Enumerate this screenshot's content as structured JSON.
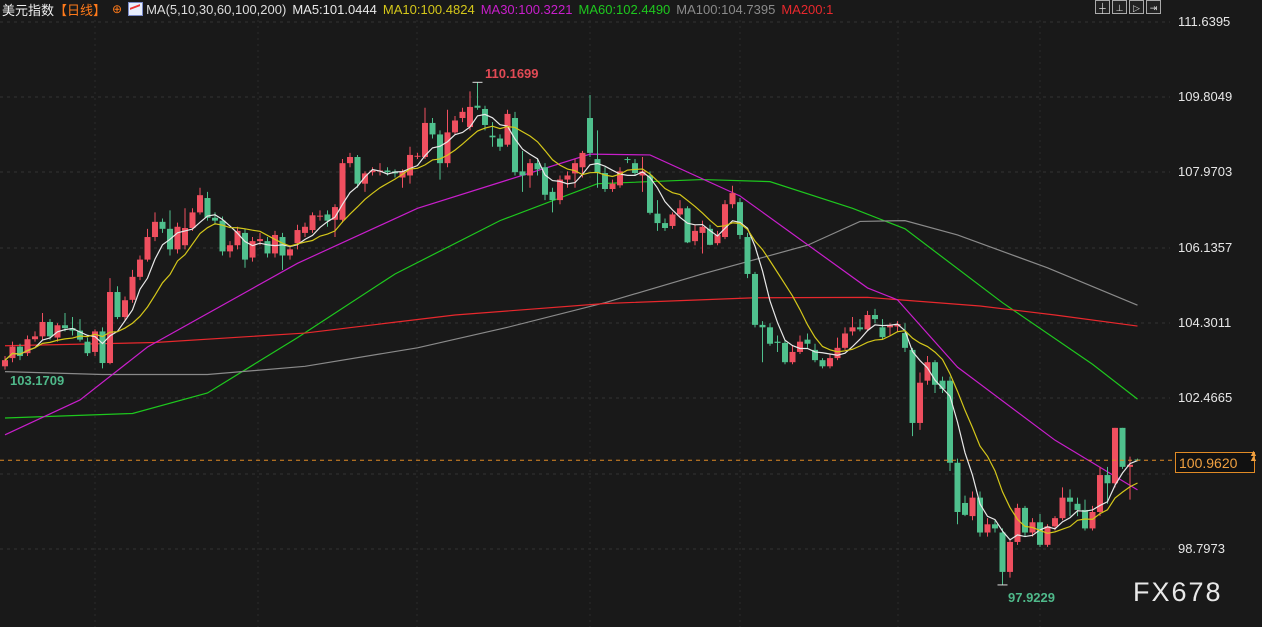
{
  "header": {
    "title": "美元指数",
    "period": "【日线】",
    "ma_set": "MA(5,10,30,60,100,200)",
    "ma_labels": [
      {
        "text": "MA5:101.0444",
        "color": "#e8e8e8"
      },
      {
        "text": "MA10:100.4824",
        "color": "#d4c71a"
      },
      {
        "text": "MA30:100.3221",
        "color": "#c81ecb"
      },
      {
        "text": "MA60:102.4490",
        "color": "#1ec81e"
      },
      {
        "text": "MA100:104.7395",
        "color": "#8a8a8a"
      },
      {
        "text": "MA200:1",
        "color": "#e8282d"
      }
    ]
  },
  "toolbar": [
    "crosshair-icon",
    "zoom-range-icon",
    "play-icon",
    "exit-icon"
  ],
  "axis": {
    "labels": [
      "111.6395",
      "109.8049",
      "107.9703",
      "106.1357",
      "104.3011",
      "102.4665",
      "98.7973"
    ],
    "current_price": "100.9620"
  },
  "annotations": {
    "high": "110.1699",
    "low_left": "103.1709",
    "low": "97.9229"
  },
  "watermark": "FX678",
  "colors": {
    "up": "#ef4f5f",
    "down": "#4fc08d",
    "background": "#191919",
    "current_line": "#e08a25"
  },
  "chart_data": {
    "type": "candlestick",
    "ylim": [
      97.5,
      111.6395
    ],
    "grid": true,
    "ohlc": [
      [
        103.25,
        103.5,
        103.17,
        103.4
      ],
      [
        103.45,
        103.85,
        103.35,
        103.73
      ],
      [
        103.73,
        103.8,
        103.4,
        103.5
      ],
      [
        103.57,
        104.0,
        103.5,
        103.91
      ],
      [
        103.91,
        104.1,
        103.85,
        103.98
      ],
      [
        103.98,
        104.55,
        103.9,
        104.33
      ],
      [
        104.33,
        104.4,
        103.9,
        103.98
      ],
      [
        103.95,
        104.3,
        103.85,
        104.25
      ],
      [
        104.25,
        104.55,
        104.1,
        104.18
      ],
      [
        104.18,
        104.45,
        104.0,
        104.12
      ],
      [
        104.12,
        104.4,
        103.85,
        103.9
      ],
      [
        103.85,
        103.95,
        103.5,
        103.57
      ],
      [
        103.6,
        104.15,
        103.5,
        104.1
      ],
      [
        104.1,
        104.2,
        103.2,
        103.33
      ],
      [
        103.33,
        105.4,
        103.3,
        105.06
      ],
      [
        105.06,
        105.2,
        104.4,
        104.45
      ],
      [
        104.45,
        104.95,
        104.35,
        104.86
      ],
      [
        104.87,
        105.6,
        104.8,
        105.43
      ],
      [
        105.43,
        105.95,
        105.35,
        105.85
      ],
      [
        105.85,
        106.6,
        105.8,
        106.4
      ],
      [
        106.4,
        107.0,
        106.3,
        106.77
      ],
      [
        106.77,
        106.85,
        106.5,
        106.6
      ],
      [
        106.6,
        107.05,
        105.95,
        106.1
      ],
      [
        106.1,
        106.75,
        106.0,
        106.65
      ],
      [
        106.2,
        107.1,
        106.1,
        106.62
      ],
      [
        106.62,
        107.1,
        106.55,
        107.0
      ],
      [
        107.0,
        107.6,
        106.95,
        107.42
      ],
      [
        107.35,
        107.5,
        106.8,
        106.87
      ],
      [
        106.87,
        107.0,
        106.7,
        106.8
      ],
      [
        106.8,
        106.9,
        105.95,
        106.05
      ],
      [
        106.05,
        106.3,
        105.9,
        106.2
      ],
      [
        106.2,
        106.65,
        106.1,
        106.55
      ],
      [
        106.5,
        106.6,
        105.65,
        105.85
      ],
      [
        105.9,
        106.4,
        105.8,
        106.3
      ],
      [
        106.3,
        106.5,
        106.2,
        106.35
      ],
      [
        106.3,
        106.4,
        105.9,
        106.0
      ],
      [
        106.0,
        106.55,
        105.9,
        106.45
      ],
      [
        106.4,
        106.5,
        105.6,
        105.95
      ],
      [
        105.95,
        106.2,
        105.85,
        106.1
      ],
      [
        106.25,
        106.7,
        106.1,
        106.57
      ],
      [
        106.5,
        106.75,
        106.4,
        106.65
      ],
      [
        106.57,
        107.0,
        106.5,
        106.93
      ],
      [
        106.9,
        107.05,
        106.8,
        106.92
      ],
      [
        106.95,
        107.05,
        106.65,
        106.8
      ],
      [
        106.82,
        107.2,
        106.4,
        107.13
      ],
      [
        106.82,
        108.3,
        106.75,
        108.2
      ],
      [
        108.2,
        108.45,
        108.1,
        108.35
      ],
      [
        108.35,
        108.4,
        107.6,
        107.7
      ],
      [
        107.7,
        108.0,
        107.5,
        107.95
      ],
      [
        107.98,
        108.1,
        107.9,
        108.02
      ],
      [
        108.0,
        108.2,
        107.9,
        108.02
      ],
      [
        108.02,
        108.1,
        107.9,
        107.98
      ],
      [
        108.0,
        108.05,
        107.85,
        107.95
      ],
      [
        107.85,
        108.05,
        107.6,
        108.0
      ],
      [
        107.9,
        108.6,
        107.7,
        108.4
      ],
      [
        108.37,
        108.45,
        108.3,
        108.38
      ],
      [
        108.35,
        109.55,
        108.3,
        109.18
      ],
      [
        109.18,
        109.3,
        108.8,
        108.9
      ],
      [
        108.9,
        109.0,
        107.8,
        108.2
      ],
      [
        108.2,
        109.5,
        108.1,
        108.95
      ],
      [
        108.95,
        109.35,
        108.9,
        109.24
      ],
      [
        109.3,
        109.55,
        109.2,
        109.45
      ],
      [
        109.08,
        109.95,
        109.0,
        109.57
      ],
      [
        109.6,
        110.1699,
        109.5,
        109.55
      ],
      [
        109.52,
        109.6,
        109.0,
        109.13
      ],
      [
        108.87,
        109.2,
        108.6,
        108.83
      ],
      [
        108.8,
        108.9,
        108.5,
        108.6
      ],
      [
        108.65,
        109.5,
        108.6,
        109.4
      ],
      [
        109.3,
        109.45,
        107.9,
        107.98
      ],
      [
        108.0,
        108.5,
        107.5,
        107.9
      ],
      [
        107.9,
        108.3,
        107.6,
        108.2
      ],
      [
        108.2,
        108.3,
        107.9,
        108.05
      ],
      [
        108.1,
        108.2,
        107.3,
        107.43
      ],
      [
        107.5,
        107.6,
        107.0,
        107.3
      ],
      [
        107.3,
        107.9,
        107.2,
        107.8
      ],
      [
        107.8,
        108.0,
        107.6,
        107.9
      ],
      [
        107.95,
        108.3,
        107.6,
        108.2
      ],
      [
        108.1,
        108.5,
        107.85,
        108.45
      ],
      [
        109.3,
        109.86,
        108.35,
        108.45
      ],
      [
        108.3,
        109.0,
        107.6,
        107.96
      ],
      [
        107.96,
        108.1,
        107.5,
        107.57
      ],
      [
        107.57,
        107.8,
        107.5,
        107.7
      ],
      [
        107.66,
        108.1,
        107.6,
        108.0
      ],
      [
        108.3,
        108.35,
        108.2,
        108.28
      ],
      [
        108.2,
        108.3,
        107.9,
        107.96
      ],
      [
        107.9,
        108.35,
        107.5,
        108.0
      ],
      [
        107.9,
        108.0,
        106.95,
        106.99
      ],
      [
        106.97,
        107.3,
        106.55,
        106.74
      ],
      [
        106.74,
        106.85,
        106.55,
        106.62
      ],
      [
        106.67,
        107.0,
        106.6,
        106.95
      ],
      [
        106.95,
        107.3,
        106.9,
        107.1
      ],
      [
        107.1,
        107.15,
        106.25,
        106.27
      ],
      [
        106.3,
        106.7,
        106.2,
        106.55
      ],
      [
        106.5,
        106.8,
        106.0,
        106.65
      ],
      [
        106.6,
        106.7,
        106.2,
        106.21
      ],
      [
        106.25,
        106.55,
        106.2,
        106.45
      ],
      [
        106.4,
        107.3,
        106.35,
        107.2
      ],
      [
        107.2,
        107.65,
        107.1,
        107.47
      ],
      [
        107.25,
        107.35,
        106.35,
        106.45
      ],
      [
        106.4,
        106.5,
        105.4,
        105.5
      ],
      [
        105.5,
        105.55,
        104.2,
        104.26
      ],
      [
        104.26,
        104.35,
        103.35,
        104.2
      ],
      [
        104.2,
        104.3,
        103.75,
        103.8
      ],
      [
        103.85,
        104.0,
        103.6,
        103.82
      ],
      [
        103.82,
        103.9,
        103.3,
        103.35
      ],
      [
        103.35,
        103.75,
        103.3,
        103.6
      ],
      [
        103.6,
        104.0,
        103.55,
        103.85
      ],
      [
        103.9,
        104.05,
        103.7,
        103.8
      ],
      [
        103.65,
        103.8,
        103.35,
        103.4
      ],
      [
        103.4,
        103.45,
        103.2,
        103.25
      ],
      [
        103.25,
        103.55,
        103.2,
        103.45
      ],
      [
        103.45,
        103.95,
        103.4,
        103.7
      ],
      [
        103.7,
        104.2,
        103.65,
        104.05
      ],
      [
        104.1,
        104.45,
        104.0,
        104.2
      ],
      [
        104.2,
        104.4,
        104.1,
        104.15
      ],
      [
        104.15,
        104.6,
        104.1,
        104.5
      ],
      [
        104.5,
        104.65,
        104.3,
        104.4
      ],
      [
        104.2,
        104.4,
        103.9,
        103.96
      ],
      [
        104.2,
        104.3,
        104.0,
        104.25
      ],
      [
        104.22,
        104.35,
        104.1,
        104.28
      ],
      [
        104.06,
        104.3,
        103.6,
        103.7
      ],
      [
        103.65,
        103.7,
        101.55,
        101.87
      ],
      [
        101.87,
        103.1,
        101.7,
        102.85
      ],
      [
        102.9,
        103.5,
        102.8,
        103.35
      ],
      [
        103.35,
        103.4,
        102.6,
        102.8
      ],
      [
        102.9,
        103.0,
        102.6,
        102.7
      ],
      [
        102.9,
        103.0,
        100.7,
        100.9
      ],
      [
        100.9,
        101.0,
        99.4,
        99.7
      ],
      [
        99.92,
        100.1,
        99.6,
        99.63
      ],
      [
        99.6,
        100.2,
        99.5,
        100.05
      ],
      [
        100.05,
        100.2,
        99.1,
        99.2
      ],
      [
        99.2,
        99.55,
        99.1,
        99.4
      ],
      [
        99.4,
        99.5,
        99.2,
        99.3
      ],
      [
        99.2,
        99.3,
        97.9229,
        98.24
      ],
      [
        98.24,
        99.05,
        98.1,
        98.97
      ],
      [
        98.97,
        99.9,
        98.9,
        99.8
      ],
      [
        99.8,
        99.85,
        99.1,
        99.2
      ],
      [
        99.2,
        99.55,
        99.1,
        99.45
      ],
      [
        99.45,
        99.65,
        98.85,
        98.9
      ],
      [
        98.9,
        99.4,
        98.85,
        99.35
      ],
      [
        99.35,
        99.6,
        99.25,
        99.55
      ],
      [
        99.55,
        100.3,
        99.5,
        100.05
      ],
      [
        100.05,
        100.25,
        99.6,
        99.95
      ],
      [
        99.9,
        100.05,
        99.6,
        99.75
      ],
      [
        99.75,
        100.0,
        99.25,
        99.3
      ],
      [
        99.3,
        99.85,
        99.25,
        99.7
      ],
      [
        99.7,
        100.8,
        99.6,
        100.6
      ],
      [
        100.6,
        100.8,
        99.9,
        100.4
      ],
      [
        100.4,
        101.75,
        100.3,
        101.75
      ],
      [
        101.75,
        101.75,
        100.75,
        100.8
      ],
      [
        100.8,
        101.05,
        100.0,
        100.85
      ],
      [
        100.98,
        101.0,
        100.94,
        100.96
      ]
    ],
    "ma_lines": [
      {
        "name": "MA60",
        "color": "#1ec81e",
        "points": [
          [
            0,
            101.99
          ],
          [
            17,
            102.1
          ],
          [
            27,
            102.6
          ],
          [
            39,
            103.95
          ],
          [
            52,
            105.5
          ],
          [
            66,
            106.8
          ],
          [
            79,
            107.7
          ],
          [
            93,
            107.8
          ],
          [
            102,
            107.75
          ],
          [
            113,
            107.1
          ],
          [
            120,
            106.6
          ],
          [
            133,
            104.8
          ],
          [
            145,
            103.3
          ],
          [
            151,
            102.45
          ]
        ]
      },
      {
        "name": "MA100",
        "color": "#8a8a8a",
        "points": [
          [
            0,
            103.12
          ],
          [
            13,
            103.05
          ],
          [
            27,
            103.05
          ],
          [
            40,
            103.25
          ],
          [
            55,
            103.7
          ],
          [
            67,
            104.2
          ],
          [
            80,
            104.8
          ],
          [
            93,
            105.5
          ],
          [
            107,
            106.2
          ],
          [
            114,
            106.78
          ],
          [
            120,
            106.8
          ],
          [
            127,
            106.45
          ],
          [
            139,
            105.65
          ],
          [
            151,
            104.74
          ]
        ]
      },
      {
        "name": "MA200",
        "color": "#e8282d",
        "points": [
          [
            0,
            103.75
          ],
          [
            20,
            103.83
          ],
          [
            40,
            104.06
          ],
          [
            60,
            104.5
          ],
          [
            80,
            104.78
          ],
          [
            100,
            104.92
          ],
          [
            115,
            104.93
          ],
          [
            130,
            104.72
          ],
          [
            140,
            104.5
          ],
          [
            151,
            104.23
          ]
        ]
      },
      {
        "name": "MA30",
        "color": "#c81ecb",
        "points": [
          [
            0,
            101.58
          ],
          [
            10,
            102.43
          ],
          [
            19,
            103.72
          ],
          [
            39,
            105.76
          ],
          [
            55,
            107.1
          ],
          [
            78,
            108.42
          ],
          [
            86,
            108.4
          ],
          [
            98,
            107.4
          ],
          [
            115,
            105.16
          ],
          [
            119,
            104.87
          ],
          [
            127,
            103.23
          ],
          [
            140,
            101.45
          ],
          [
            151,
            100.24
          ]
        ]
      }
    ],
    "computed_ma": [
      {
        "name": "MA5",
        "period": 5,
        "color": "#e8e8e8"
      },
      {
        "name": "MA10",
        "period": 10,
        "color": "#d4c71a"
      }
    ]
  }
}
